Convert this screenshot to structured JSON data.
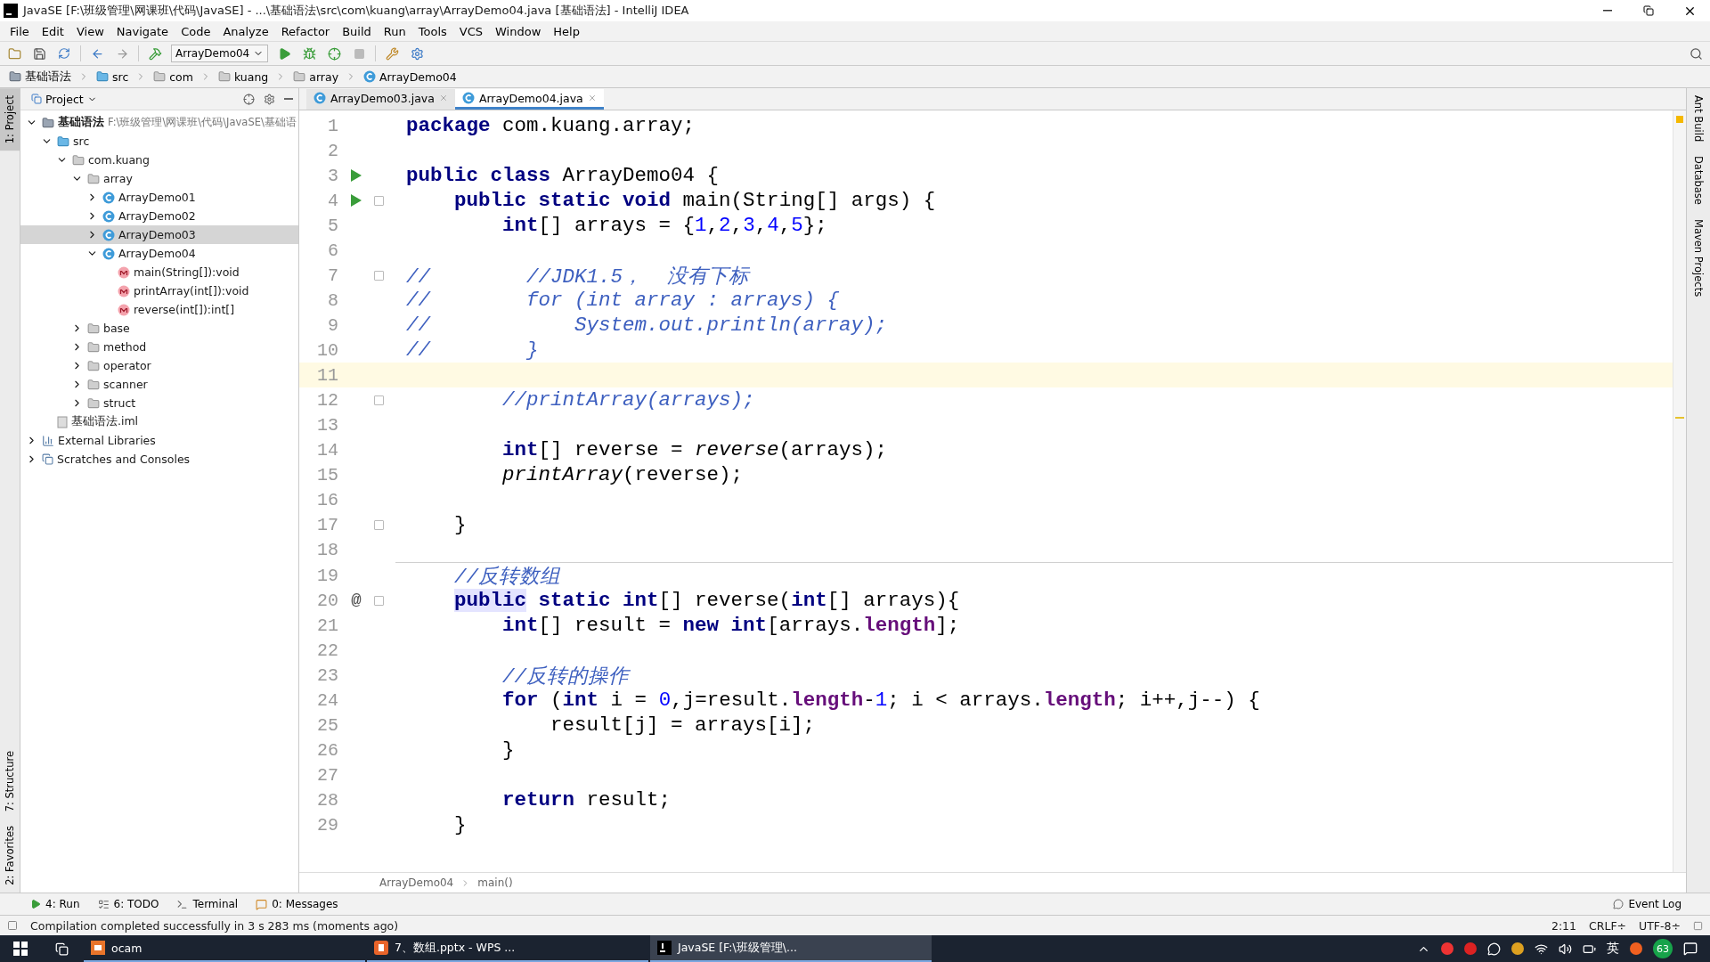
{
  "window": {
    "title": "JavaSE [F:\\班级管理\\网课班\\代码\\JavaSE] - ...\\基础语法\\src\\com\\kuang\\array\\ArrayDemo04.java [基础语法] - IntelliJ IDEA"
  },
  "menu": [
    "File",
    "Edit",
    "View",
    "Navigate",
    "Code",
    "Analyze",
    "Refactor",
    "Build",
    "Run",
    "Tools",
    "VCS",
    "Window",
    "Help"
  ],
  "toolbar": {
    "run_config": "ArrayDemo04"
  },
  "navigation": [
    {
      "label": "基础语法",
      "kind": "module"
    },
    {
      "label": "src",
      "kind": "source"
    },
    {
      "label": "com",
      "kind": "folder"
    },
    {
      "label": "kuang",
      "kind": "folder"
    },
    {
      "label": "array",
      "kind": "folder"
    },
    {
      "label": "ArrayDemo04",
      "kind": "class"
    }
  ],
  "left_stripe": [
    {
      "label": "1: Project",
      "selected": true
    },
    {
      "label": "7: Structure",
      "selected": false
    },
    {
      "label": "2: Favorites",
      "selected": false
    }
  ],
  "right_stripe": [
    "Ant Build",
    "Database",
    "Maven Projects"
  ],
  "project_panel": {
    "title": "Project",
    "tree": [
      {
        "label": "基础语法",
        "path": "F:\\班级管理\\网课班\\代码\\JavaSE\\基础语",
        "kind": "module",
        "expanded": true,
        "selected": false,
        "children": [
          {
            "label": "src",
            "kind": "source",
            "expanded": true,
            "selected": false,
            "children": [
              {
                "label": "com.kuang",
                "kind": "package",
                "expanded": true,
                "selected": false,
                "children": [
                  {
                    "label": "array",
                    "kind": "package",
                    "expanded": true,
                    "selected": false,
                    "children": [
                      {
                        "label": "ArrayDemo01",
                        "kind": "class",
                        "expanded": false,
                        "selected": false
                      },
                      {
                        "label": "ArrayDemo02",
                        "kind": "class",
                        "expanded": false,
                        "selected": false
                      },
                      {
                        "label": "ArrayDemo03",
                        "kind": "class",
                        "expanded": false,
                        "selected": true
                      },
                      {
                        "label": "ArrayDemo04",
                        "kind": "class",
                        "expanded": true,
                        "selected": false,
                        "children": [
                          {
                            "label": "main(String[]):void",
                            "kind": "method",
                            "selected": false
                          },
                          {
                            "label": "printArray(int[]):void",
                            "kind": "method",
                            "selected": false
                          },
                          {
                            "label": "reverse(int[]):int[]",
                            "kind": "method",
                            "selected": false
                          }
                        ]
                      }
                    ]
                  },
                  {
                    "label": "base",
                    "kind": "package",
                    "expanded": false,
                    "selected": false
                  },
                  {
                    "label": "method",
                    "kind": "package",
                    "expanded": false,
                    "selected": false
                  },
                  {
                    "label": "operator",
                    "kind": "package",
                    "expanded": false,
                    "selected": false
                  },
                  {
                    "label": "scanner",
                    "kind": "package",
                    "expanded": false,
                    "selected": false
                  },
                  {
                    "label": "struct",
                    "kind": "package",
                    "expanded": false,
                    "selected": false
                  }
                ]
              }
            ]
          },
          {
            "label": "基础语法.iml",
            "kind": "file",
            "selected": false
          }
        ]
      },
      {
        "label": "External Libraries",
        "kind": "library",
        "expanded": false,
        "selected": false
      },
      {
        "label": "Scratches and Consoles",
        "kind": "scratches",
        "expanded": false,
        "selected": false
      }
    ]
  },
  "tabs": [
    {
      "label": "ArrayDemo03.java",
      "selected": false
    },
    {
      "label": "ArrayDemo04.java",
      "selected": true
    }
  ],
  "code_lines": [
    {
      "number": "1",
      "tokens": [
        {
          "kind": "keyword",
          "text": "package"
        },
        {
          "kind": "plain",
          "text": " com.kuang.array;"
        }
      ]
    },
    {
      "number": "2"
    },
    {
      "number": "3",
      "run_marker": true,
      "tokens": [
        {
          "kind": "keyword",
          "text": "public"
        },
        {
          "kind": "keyword",
          "text": " class"
        },
        {
          "kind": "plain",
          "text": " ArrayDemo04 {"
        }
      ]
    },
    {
      "number": "4",
      "run_marker": true,
      "fold": true,
      "tokens": [
        {
          "kind": "keyword",
          "text": "    public"
        },
        {
          "kind": "keyword",
          "text": " static"
        },
        {
          "kind": "keyword",
          "text": " void"
        },
        {
          "kind": "plain",
          "text": " main(String[] args) {"
        }
      ]
    },
    {
      "number": "5",
      "tokens": [
        {
          "kind": "keyword",
          "text": "        int"
        },
        {
          "kind": "plain",
          "text": "[] arrays = {"
        },
        {
          "kind": "number",
          "text": "1"
        },
        {
          "kind": "plain",
          "text": ","
        },
        {
          "kind": "number",
          "text": "2"
        },
        {
          "kind": "plain",
          "text": ","
        },
        {
          "kind": "number",
          "text": "3"
        },
        {
          "kind": "plain",
          "text": ","
        },
        {
          "kind": "number",
          "text": "4"
        },
        {
          "kind": "plain",
          "text": ","
        },
        {
          "kind": "number",
          "text": "5"
        },
        {
          "kind": "plain",
          "text": "};"
        }
      ]
    },
    {
      "number": "6"
    },
    {
      "number": "7",
      "fold": true,
      "tokens": [
        {
          "kind": "comment",
          "text": "//        //JDK1.5，  没有下标"
        }
      ]
    },
    {
      "number": "8",
      "tokens": [
        {
          "kind": "comment",
          "text": "//        for (int array : arrays) {"
        }
      ]
    },
    {
      "number": "9",
      "tokens": [
        {
          "kind": "comment",
          "text": "//            System.out.println(array);"
        }
      ]
    },
    {
      "number": "10",
      "tokens": [
        {
          "kind": "comment",
          "text": "//        }"
        }
      ]
    },
    {
      "number": "11",
      "current": true
    },
    {
      "number": "12",
      "fold": true,
      "tokens": [
        {
          "kind": "comment",
          "text": "        //printArray(arrays);"
        }
      ]
    },
    {
      "number": "13"
    },
    {
      "number": "14",
      "tokens": [
        {
          "kind": "keyword",
          "text": "        int"
        },
        {
          "kind": "plain",
          "text": "[] reverse = "
        },
        {
          "kind": "call",
          "text": "reverse"
        },
        {
          "kind": "plain",
          "text": "(arrays);"
        }
      ]
    },
    {
      "number": "15",
      "tokens": [
        {
          "kind": "call",
          "text": "        printArray"
        },
        {
          "kind": "plain",
          "text": "(reverse);"
        }
      ]
    },
    {
      "number": "16"
    },
    {
      "number": "17",
      "fold": true,
      "tokens": [
        {
          "kind": "plain",
          "text": "    }"
        }
      ]
    },
    {
      "number": "18"
    },
    {
      "number": "19",
      "separator": true,
      "tokens": [
        {
          "kind": "comment",
          "text": "    //反转数组"
        }
      ]
    },
    {
      "number": "20",
      "gutter_text": "@",
      "fold": true,
      "tokens": [
        {
          "kind": "highlighted_keyword",
          "text": "    public"
        },
        {
          "kind": "keyword",
          "text": " static"
        },
        {
          "kind": "keyword",
          "text": " int"
        },
        {
          "kind": "plain",
          "text": "[] reverse("
        },
        {
          "kind": "keyword",
          "text": "int"
        },
        {
          "kind": "plain",
          "text": "[] arrays){"
        }
      ]
    },
    {
      "number": "21",
      "tokens": [
        {
          "kind": "keyword",
          "text": "        int"
        },
        {
          "kind": "plain",
          "text": "[] result = "
        },
        {
          "kind": "keyword",
          "text": "new"
        },
        {
          "kind": "keyword",
          "text": " int"
        },
        {
          "kind": "plain",
          "text": "[arrays."
        },
        {
          "kind": "field",
          "text": "length"
        },
        {
          "kind": "plain",
          "text": "];"
        }
      ]
    },
    {
      "number": "22"
    },
    {
      "number": "23",
      "tokens": [
        {
          "kind": "comment",
          "text": "        //反转的操作"
        }
      ]
    },
    {
      "number": "24",
      "tokens": [
        {
          "kind": "keyword",
          "text": "        for"
        },
        {
          "kind": "plain",
          "text": " ("
        },
        {
          "kind": "keyword",
          "text": "int"
        },
        {
          "kind": "plain",
          "text": " i = "
        },
        {
          "kind": "number",
          "text": "0"
        },
        {
          "kind": "plain",
          "text": ",j=result."
        },
        {
          "kind": "field",
          "text": "length"
        },
        {
          "kind": "plain",
          "text": "-"
        },
        {
          "kind": "number",
          "text": "1"
        },
        {
          "kind": "plain",
          "text": "; i < arrays."
        },
        {
          "kind": "field",
          "text": "length"
        },
        {
          "kind": "plain",
          "text": "; i++,j--) {"
        }
      ]
    },
    {
      "number": "25",
      "tokens": [
        {
          "kind": "plain",
          "text": "            result[j] = arrays[i];"
        }
      ]
    },
    {
      "number": "26",
      "tokens": [
        {
          "kind": "plain",
          "text": "        }"
        }
      ]
    },
    {
      "number": "27"
    },
    {
      "number": "28",
      "tokens": [
        {
          "kind": "keyword",
          "text": "        return"
        },
        {
          "kind": "plain",
          "text": " result;"
        }
      ]
    },
    {
      "number": "29",
      "tokens": [
        {
          "kind": "plain",
          "text": "    }"
        }
      ]
    }
  ],
  "editor_breadcrumb": [
    "ArrayDemo04",
    "main()"
  ],
  "tool_buttons": [
    {
      "label": "4: Run",
      "kind": "run"
    },
    {
      "label": "6: TODO",
      "kind": "todo"
    },
    {
      "label": "Terminal",
      "kind": "terminal"
    },
    {
      "label": "0: Messages",
      "kind": "messages"
    }
  ],
  "event_log": "Event Log",
  "status_bar": {
    "message": "Compilation completed successfully in 3 s 283 ms (moments ago)",
    "position": "2:11",
    "line_separator": "CRLF÷",
    "encoding": "UTF-8÷"
  },
  "taskbar": {
    "apps": [
      {
        "label": "ocam",
        "kind": "ocam",
        "selected": false
      },
      {
        "label": "7、数组.pptx - WPS ...",
        "kind": "wps",
        "selected": false
      },
      {
        "label": "JavaSE [F:\\班级管理\\...",
        "kind": "idea",
        "selected": true
      }
    ],
    "language": "英",
    "badge": "63"
  }
}
